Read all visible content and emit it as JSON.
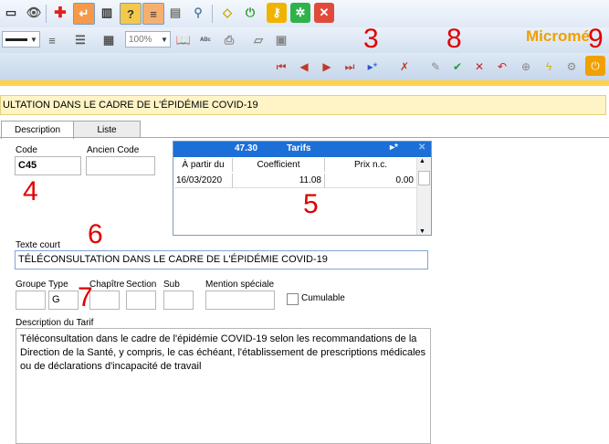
{
  "toolbar": {
    "zoom": "100%",
    "brand": "Micromé"
  },
  "window": {
    "title": "ULTATION DANS LE CADRE DE L'ÉPIDÉMIE COVID-19"
  },
  "tabs": [
    {
      "label": "Description",
      "active": true
    },
    {
      "label": "Liste",
      "active": false
    }
  ],
  "form": {
    "code_label": "Code",
    "code_value": "C45",
    "ancien_code_label": "Ancien Code",
    "ancien_code_value": "",
    "texte_court_label": "Texte court",
    "texte_court_value": "TÉLÉCONSULTATION DANS LE CADRE DE L'ÉPIDÉMIE COVID-19",
    "groupe_label": "Groupe",
    "type_label": "Type",
    "type_value": "G",
    "chapitre_label": "Chapître",
    "section_label": "Section",
    "sub_label": "Sub",
    "mention_label": "Mention spéciale",
    "cumulable_label": "Cumulable",
    "description_label": "Description du Tarif",
    "description_value": "Téléconsultation dans le cadre de l'épidémie COVID-19 selon les recommandations de la Direction de la Santé, y compris, le cas échéant, l'établissement de prescriptions médicales ou de déclarations d'incapacité de travail"
  },
  "tarifs": {
    "number": "47.30",
    "title": "Tarifs",
    "columns": [
      "À partir du",
      "Coefficient",
      "Prix n.c."
    ],
    "rows": [
      {
        "date": "16/03/2020",
        "coefficient": "11.08",
        "prix": "0.00"
      }
    ]
  },
  "annotations": {
    "n3": "3",
    "n8": "8",
    "n9": "9",
    "n4": "4",
    "n5": "5",
    "n6": "6",
    "n7": "7",
    "color": "#e00000"
  }
}
